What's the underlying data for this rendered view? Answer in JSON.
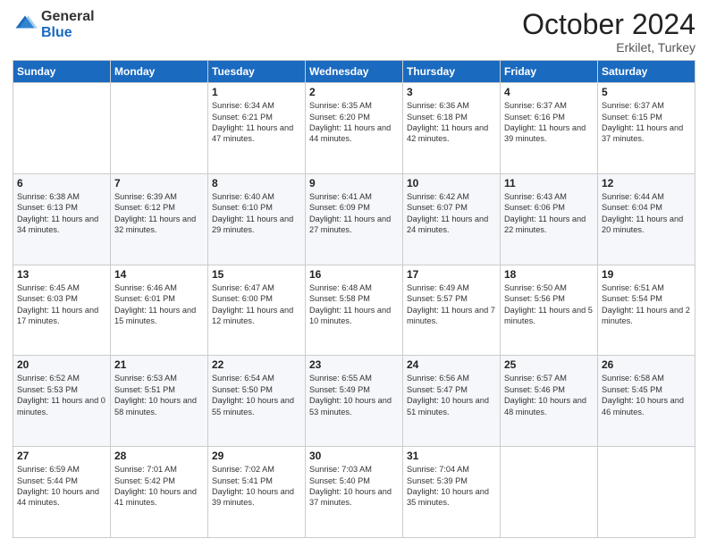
{
  "logo": {
    "general": "General",
    "blue": "Blue"
  },
  "header": {
    "month": "October 2024",
    "location": "Erkilet, Turkey"
  },
  "days_of_week": [
    "Sunday",
    "Monday",
    "Tuesday",
    "Wednesday",
    "Thursday",
    "Friday",
    "Saturday"
  ],
  "weeks": [
    [
      {
        "day": "",
        "sunrise": "",
        "sunset": "",
        "daylight": ""
      },
      {
        "day": "",
        "sunrise": "",
        "sunset": "",
        "daylight": ""
      },
      {
        "day": "1",
        "sunrise": "Sunrise: 6:34 AM",
        "sunset": "Sunset: 6:21 PM",
        "daylight": "Daylight: 11 hours and 47 minutes."
      },
      {
        "day": "2",
        "sunrise": "Sunrise: 6:35 AM",
        "sunset": "Sunset: 6:20 PM",
        "daylight": "Daylight: 11 hours and 44 minutes."
      },
      {
        "day": "3",
        "sunrise": "Sunrise: 6:36 AM",
        "sunset": "Sunset: 6:18 PM",
        "daylight": "Daylight: 11 hours and 42 minutes."
      },
      {
        "day": "4",
        "sunrise": "Sunrise: 6:37 AM",
        "sunset": "Sunset: 6:16 PM",
        "daylight": "Daylight: 11 hours and 39 minutes."
      },
      {
        "day": "5",
        "sunrise": "Sunrise: 6:37 AM",
        "sunset": "Sunset: 6:15 PM",
        "daylight": "Daylight: 11 hours and 37 minutes."
      }
    ],
    [
      {
        "day": "6",
        "sunrise": "Sunrise: 6:38 AM",
        "sunset": "Sunset: 6:13 PM",
        "daylight": "Daylight: 11 hours and 34 minutes."
      },
      {
        "day": "7",
        "sunrise": "Sunrise: 6:39 AM",
        "sunset": "Sunset: 6:12 PM",
        "daylight": "Daylight: 11 hours and 32 minutes."
      },
      {
        "day": "8",
        "sunrise": "Sunrise: 6:40 AM",
        "sunset": "Sunset: 6:10 PM",
        "daylight": "Daylight: 11 hours and 29 minutes."
      },
      {
        "day": "9",
        "sunrise": "Sunrise: 6:41 AM",
        "sunset": "Sunset: 6:09 PM",
        "daylight": "Daylight: 11 hours and 27 minutes."
      },
      {
        "day": "10",
        "sunrise": "Sunrise: 6:42 AM",
        "sunset": "Sunset: 6:07 PM",
        "daylight": "Daylight: 11 hours and 24 minutes."
      },
      {
        "day": "11",
        "sunrise": "Sunrise: 6:43 AM",
        "sunset": "Sunset: 6:06 PM",
        "daylight": "Daylight: 11 hours and 22 minutes."
      },
      {
        "day": "12",
        "sunrise": "Sunrise: 6:44 AM",
        "sunset": "Sunset: 6:04 PM",
        "daylight": "Daylight: 11 hours and 20 minutes."
      }
    ],
    [
      {
        "day": "13",
        "sunrise": "Sunrise: 6:45 AM",
        "sunset": "Sunset: 6:03 PM",
        "daylight": "Daylight: 11 hours and 17 minutes."
      },
      {
        "day": "14",
        "sunrise": "Sunrise: 6:46 AM",
        "sunset": "Sunset: 6:01 PM",
        "daylight": "Daylight: 11 hours and 15 minutes."
      },
      {
        "day": "15",
        "sunrise": "Sunrise: 6:47 AM",
        "sunset": "Sunset: 6:00 PM",
        "daylight": "Daylight: 11 hours and 12 minutes."
      },
      {
        "day": "16",
        "sunrise": "Sunrise: 6:48 AM",
        "sunset": "Sunset: 5:58 PM",
        "daylight": "Daylight: 11 hours and 10 minutes."
      },
      {
        "day": "17",
        "sunrise": "Sunrise: 6:49 AM",
        "sunset": "Sunset: 5:57 PM",
        "daylight": "Daylight: 11 hours and 7 minutes."
      },
      {
        "day": "18",
        "sunrise": "Sunrise: 6:50 AM",
        "sunset": "Sunset: 5:56 PM",
        "daylight": "Daylight: 11 hours and 5 minutes."
      },
      {
        "day": "19",
        "sunrise": "Sunrise: 6:51 AM",
        "sunset": "Sunset: 5:54 PM",
        "daylight": "Daylight: 11 hours and 2 minutes."
      }
    ],
    [
      {
        "day": "20",
        "sunrise": "Sunrise: 6:52 AM",
        "sunset": "Sunset: 5:53 PM",
        "daylight": "Daylight: 11 hours and 0 minutes."
      },
      {
        "day": "21",
        "sunrise": "Sunrise: 6:53 AM",
        "sunset": "Sunset: 5:51 PM",
        "daylight": "Daylight: 10 hours and 58 minutes."
      },
      {
        "day": "22",
        "sunrise": "Sunrise: 6:54 AM",
        "sunset": "Sunset: 5:50 PM",
        "daylight": "Daylight: 10 hours and 55 minutes."
      },
      {
        "day": "23",
        "sunrise": "Sunrise: 6:55 AM",
        "sunset": "Sunset: 5:49 PM",
        "daylight": "Daylight: 10 hours and 53 minutes."
      },
      {
        "day": "24",
        "sunrise": "Sunrise: 6:56 AM",
        "sunset": "Sunset: 5:47 PM",
        "daylight": "Daylight: 10 hours and 51 minutes."
      },
      {
        "day": "25",
        "sunrise": "Sunrise: 6:57 AM",
        "sunset": "Sunset: 5:46 PM",
        "daylight": "Daylight: 10 hours and 48 minutes."
      },
      {
        "day": "26",
        "sunrise": "Sunrise: 6:58 AM",
        "sunset": "Sunset: 5:45 PM",
        "daylight": "Daylight: 10 hours and 46 minutes."
      }
    ],
    [
      {
        "day": "27",
        "sunrise": "Sunrise: 6:59 AM",
        "sunset": "Sunset: 5:44 PM",
        "daylight": "Daylight: 10 hours and 44 minutes."
      },
      {
        "day": "28",
        "sunrise": "Sunrise: 7:01 AM",
        "sunset": "Sunset: 5:42 PM",
        "daylight": "Daylight: 10 hours and 41 minutes."
      },
      {
        "day": "29",
        "sunrise": "Sunrise: 7:02 AM",
        "sunset": "Sunset: 5:41 PM",
        "daylight": "Daylight: 10 hours and 39 minutes."
      },
      {
        "day": "30",
        "sunrise": "Sunrise: 7:03 AM",
        "sunset": "Sunset: 5:40 PM",
        "daylight": "Daylight: 10 hours and 37 minutes."
      },
      {
        "day": "31",
        "sunrise": "Sunrise: 7:04 AM",
        "sunset": "Sunset: 5:39 PM",
        "daylight": "Daylight: 10 hours and 35 minutes."
      },
      {
        "day": "",
        "sunrise": "",
        "sunset": "",
        "daylight": ""
      },
      {
        "day": "",
        "sunrise": "",
        "sunset": "",
        "daylight": ""
      }
    ]
  ]
}
